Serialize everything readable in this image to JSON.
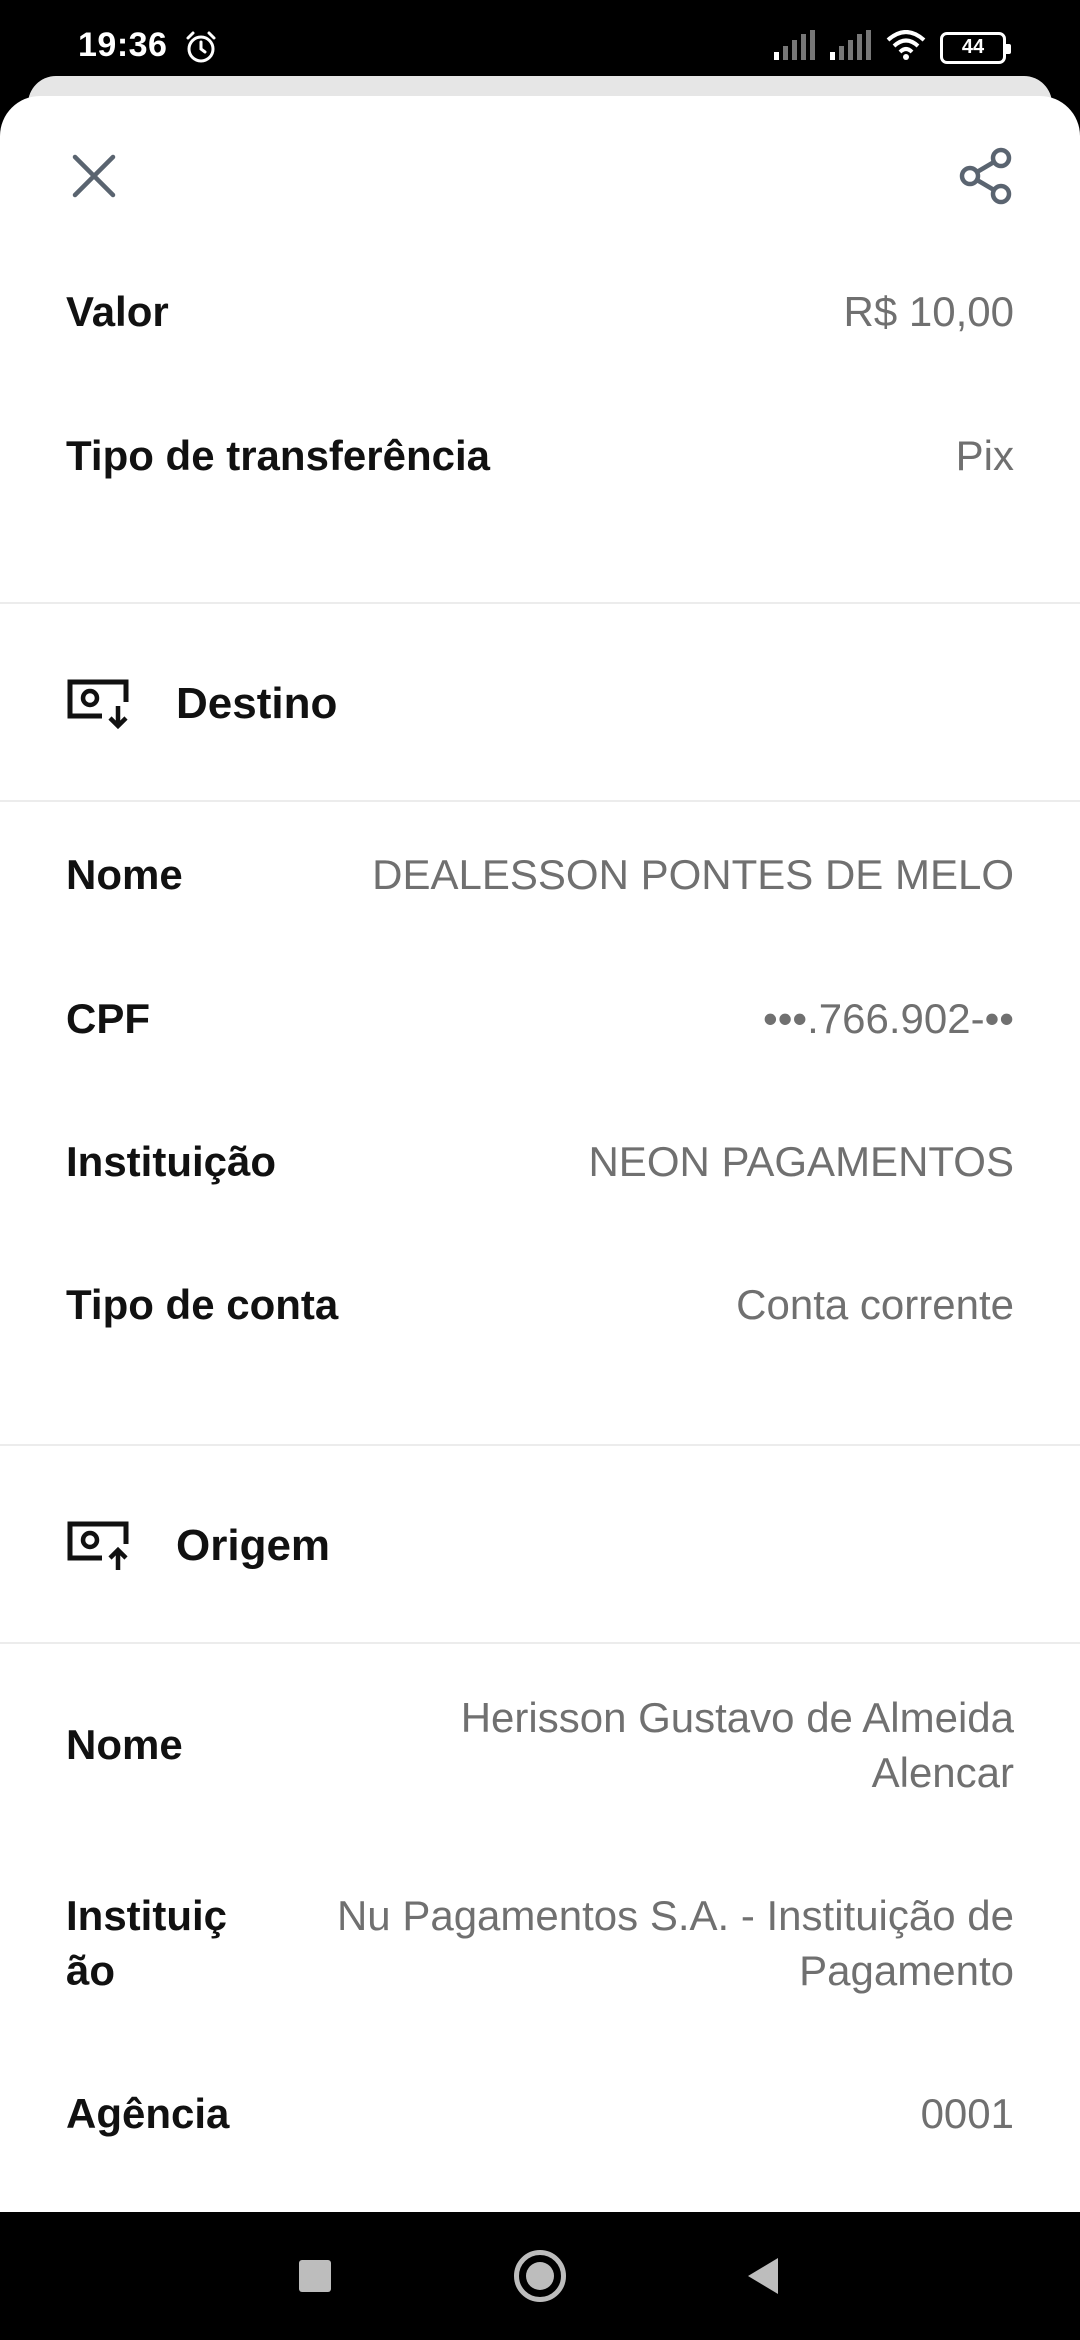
{
  "status_bar": {
    "time": "19:36",
    "battery": "44"
  },
  "header": {
    "close_icon": "close-icon",
    "share_icon": "share-icon"
  },
  "summary": {
    "valor_label": "Valor",
    "valor_value": "R$ 10,00",
    "tipo_label": "Tipo de transferência",
    "tipo_value": "Pix"
  },
  "destino": {
    "title": "Destino",
    "icon": "receive-money-icon",
    "nome_label": "Nome",
    "nome_value": "DEALESSON PONTES DE MELO",
    "cpf_label": "CPF",
    "cpf_value": "•••.766.902-••",
    "instituicao_label": "Instituição",
    "instituicao_value": "NEON PAGAMENTOS",
    "tipo_conta_label": "Tipo de conta",
    "tipo_conta_value": "Conta corrente"
  },
  "origem": {
    "title": "Origem",
    "icon": "send-money-icon",
    "nome_label": "Nome",
    "nome_value_line1": "Herisson Gustavo de Almeida",
    "nome_value_line2": "Alencar",
    "instituicao_label_line1": "Instituiç",
    "instituicao_label_line2": "ão",
    "instituicao_value_line1": "Nu Pagamentos S.A. - Instituição de",
    "instituicao_value_line2": "Pagamento",
    "agencia_label": "Agência",
    "agencia_value": "0001"
  },
  "nav": {
    "recents": "recents-icon",
    "home": "home-icon",
    "back": "back-icon"
  }
}
